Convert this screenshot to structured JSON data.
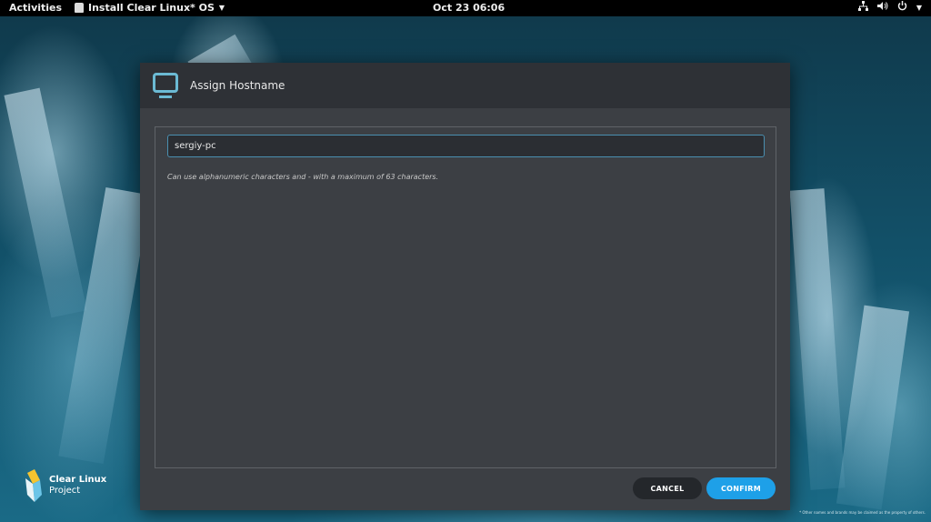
{
  "topbar": {
    "activities": "Activities",
    "app_name": "Install Clear Linux* OS",
    "clock": "Oct 23  06:06"
  },
  "dialog": {
    "title": "Assign Hostname",
    "hostname_value": "sergiy-pc",
    "hint": "Can use alphanumeric characters and - with a maximum of 63 characters.",
    "cancel_label": "CANCEL",
    "confirm_label": "CONFIRM"
  },
  "brand": {
    "line1": "Clear Linux",
    "line2": "Project"
  },
  "footnote": "* Other names and brands may be claimed as the property of others.",
  "icons": [
    "app-icon",
    "caret-down-icon",
    "network-icon",
    "volume-icon",
    "power-icon",
    "monitor-icon",
    "clear-linux-logo-icon"
  ],
  "colors": {
    "accent": "#1ea0e8",
    "dialog_bg": "#3c3f44",
    "header_bg": "#2e3136",
    "icon": "#6bbad4"
  }
}
